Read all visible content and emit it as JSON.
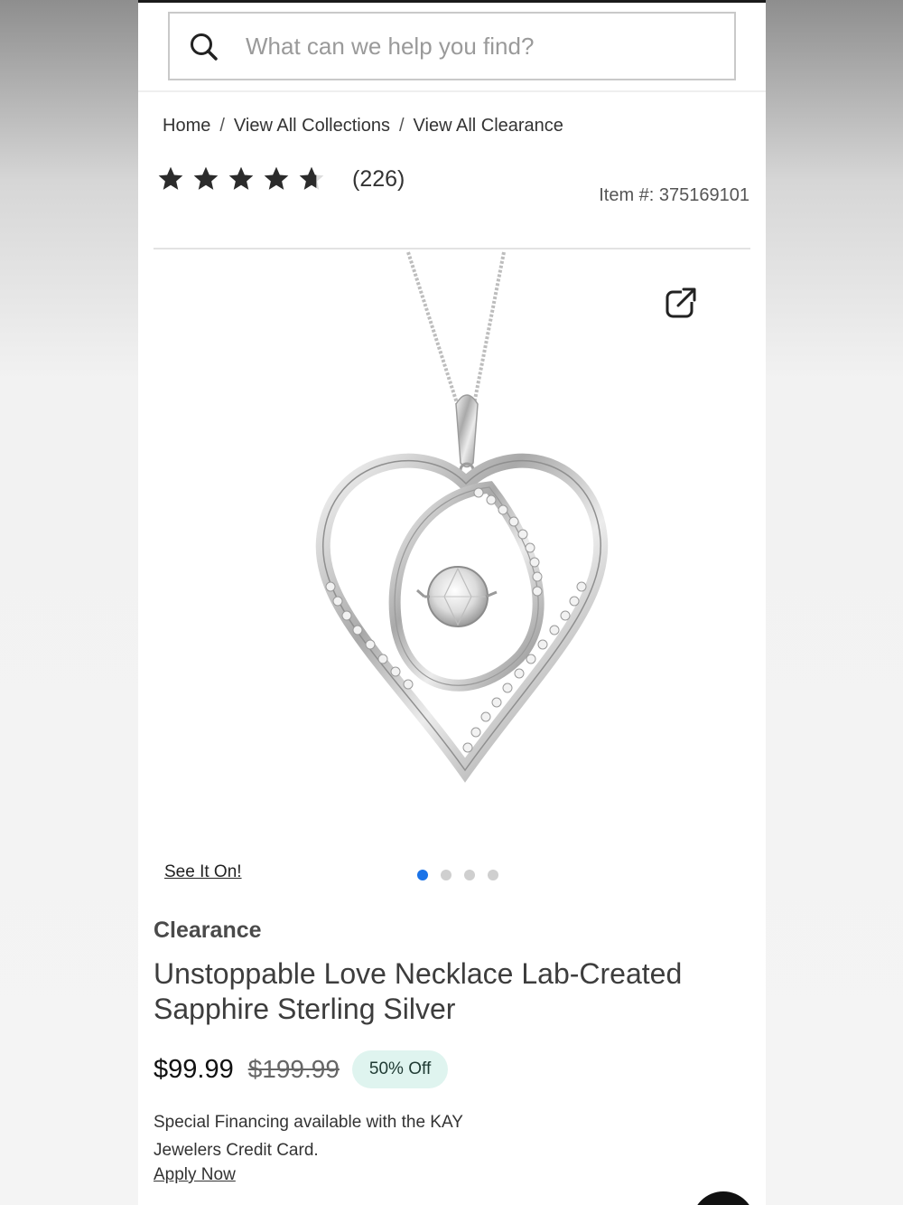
{
  "search": {
    "placeholder": "What can we help you find?"
  },
  "breadcrumb": [
    "Home",
    "View All Collections",
    "View All Clearance"
  ],
  "rating": {
    "stars": 4.5,
    "count_text": "(226)"
  },
  "item_number": "Item #: 375169101",
  "media": {
    "see_it_on": "See It On!",
    "dot_count": 4,
    "active_dot": 0,
    "accent": "#1a73e8"
  },
  "product": {
    "tag": "Clearance",
    "title": "Unstoppable Love Necklace Lab-Created Sapphire Sterling Silver",
    "price": "$99.99",
    "original_price": "$199.99",
    "discount_badge": "50% Off",
    "badge_color": "#dff4ef"
  },
  "financing": {
    "text": "Special Financing available with the KAY Jewelers Credit Card.",
    "link": "Apply Now"
  },
  "icons": [
    "search-icon",
    "star-icon",
    "share-icon",
    "chat-icon"
  ]
}
